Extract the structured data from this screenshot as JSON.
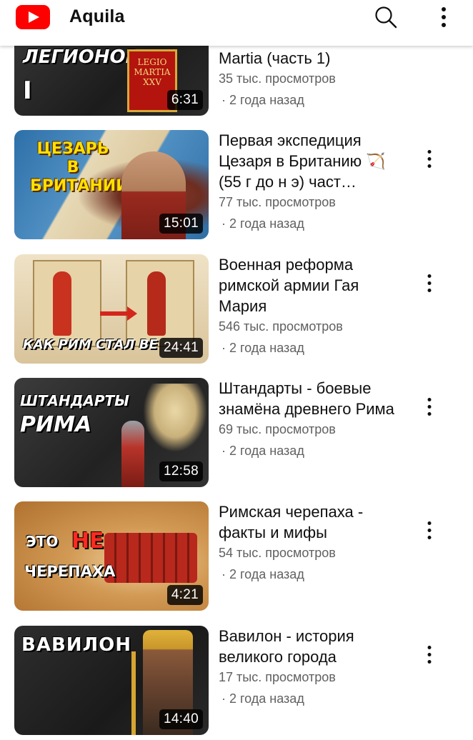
{
  "header": {
    "channel_name": "Aquila",
    "logo_icon": "youtube-logo",
    "search_icon": "search-icon",
    "menu_icon": "more-vertical-icon"
  },
  "videos": [
    {
      "title": "Martia (часть 1)",
      "views": "35 тыс. просмотров",
      "age": "· 2 года назад",
      "duration": "6:31",
      "thumb_text": [
        "ЛЕГИОНОВ",
        "I",
        "LEGIO",
        "MARTIA",
        "XXV"
      ]
    },
    {
      "title": "Первая экспедиция Цезаря в Британию 🏹 (55 г до н э) част…",
      "views": "77 тыс. просмотров",
      "age": "· 2 года назад",
      "duration": "15:01",
      "thumb_text": [
        "ЦЕЗАРЬ",
        "В",
        "БРИТАНИИ"
      ]
    },
    {
      "title": "Военная реформа римской армии Гая Мария",
      "views": "546 тыс. просмотров",
      "age": "· 2 года назад",
      "duration": "24:41",
      "thumb_text": [
        "КАК РИМ СТАЛ ВЕ"
      ]
    },
    {
      "title": "Штандарты - боевые знамёна древнего Рима",
      "views": "69 тыс. просмотров",
      "age": "· 2 года назад",
      "duration": "12:58",
      "thumb_text": [
        "ШТАНДАРТЫ",
        "РИМА"
      ]
    },
    {
      "title": "Римская черепаха - факты и мифы",
      "views": "54 тыс. просмотров",
      "age": "· 2 года назад",
      "duration": "4:21",
      "thumb_text": [
        "ЭТО",
        "НЕ",
        "ЧЕРЕПАХА"
      ]
    },
    {
      "title": "Вавилон - история великого города",
      "views": "17 тыс. просмотров",
      "age": "· 2 года назад",
      "duration": "14:40",
      "thumb_text": [
        "ВАВИЛОН"
      ]
    }
  ],
  "colors": {
    "brand_red": "#ff0000",
    "text_primary": "#0f0f0f",
    "text_secondary": "#606060"
  }
}
